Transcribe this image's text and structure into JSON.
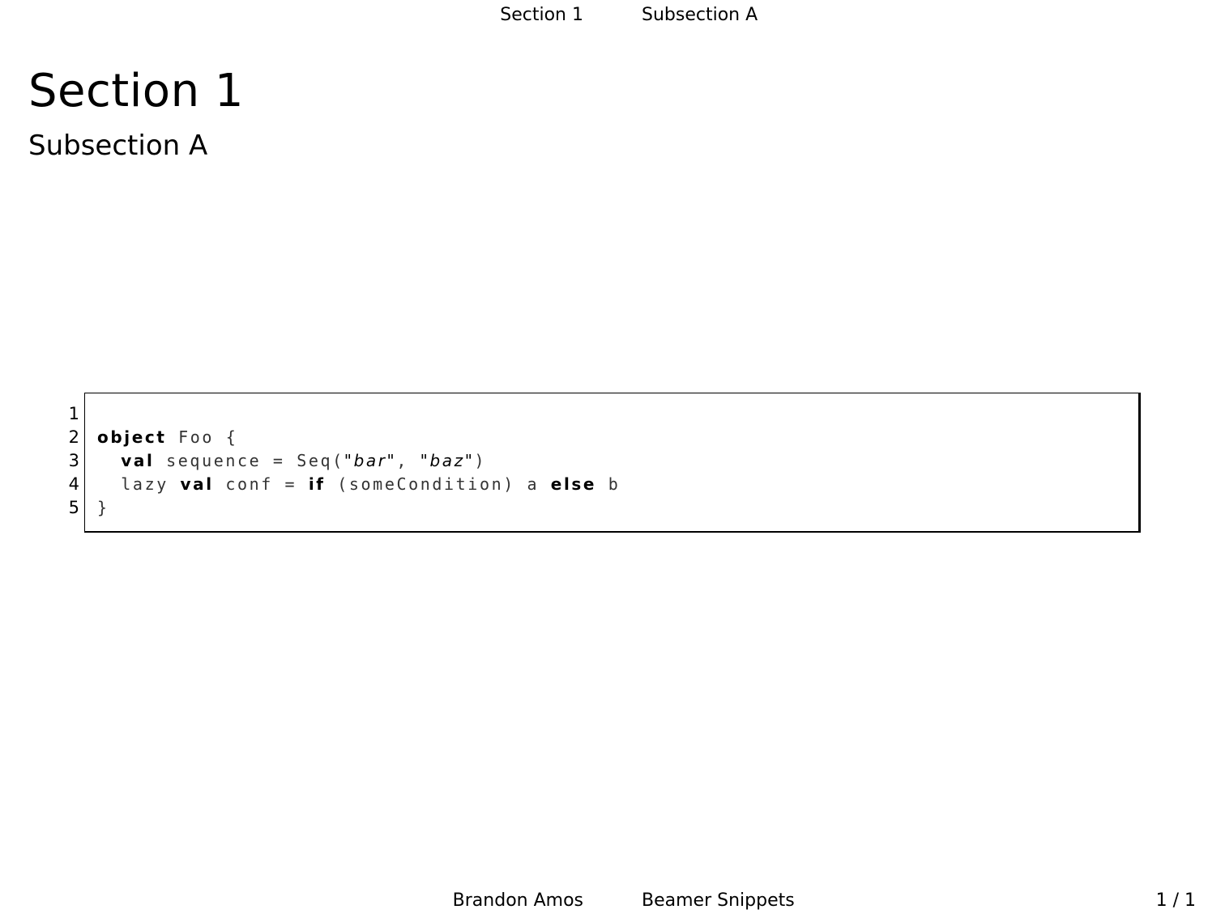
{
  "headline": {
    "section": "Section 1",
    "subsection": "Subsection A"
  },
  "frame": {
    "title": "Section 1",
    "subtitle": "Subsection A"
  },
  "listing": {
    "lines": [
      {
        "number": "1",
        "tokens": []
      },
      {
        "number": "2",
        "tokens": [
          {
            "text": "object",
            "style": "kw"
          },
          {
            "text": " Foo {",
            "style": "plain"
          }
        ]
      },
      {
        "number": "3",
        "tokens": [
          {
            "text": "  ",
            "style": "plain"
          },
          {
            "text": "val",
            "style": "kw"
          },
          {
            "text": " sequence = Seq(",
            "style": "plain"
          },
          {
            "text": "\"bar\"",
            "style": "str"
          },
          {
            "text": ", ",
            "style": "plain"
          },
          {
            "text": "\"baz\"",
            "style": "str"
          },
          {
            "text": ")",
            "style": "plain"
          }
        ]
      },
      {
        "number": "4",
        "tokens": [
          {
            "text": "  lazy ",
            "style": "plain"
          },
          {
            "text": "val",
            "style": "kw"
          },
          {
            "text": " conf = ",
            "style": "plain"
          },
          {
            "text": "if",
            "style": "kw"
          },
          {
            "text": " (someCondition) a ",
            "style": "plain"
          },
          {
            "text": "else",
            "style": "kw"
          },
          {
            "text": " b",
            "style": "plain"
          }
        ]
      },
      {
        "number": "5",
        "tokens": [
          {
            "text": "}",
            "style": "plain"
          }
        ]
      }
    ]
  },
  "footline": {
    "author": "Brandon Amos",
    "title": "Beamer Snippets",
    "page": "1 / 1"
  }
}
